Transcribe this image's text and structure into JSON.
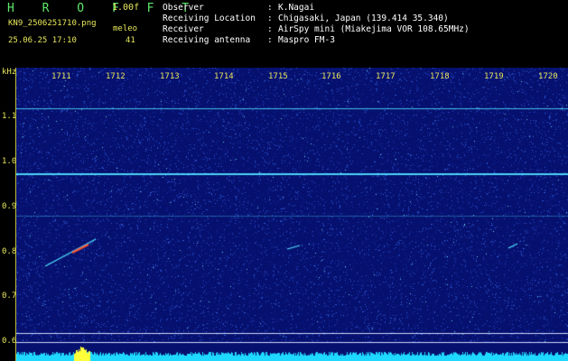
{
  "header": {
    "brand": "H R O F F T",
    "version": "1.00f",
    "filename": "KN9_2506251710.png",
    "meleo_label": "meleo",
    "meleo_value": "41",
    "datetime": "25.06.25 17:10"
  },
  "station": {
    "observer_label": "Observer",
    "observer_value": "K.Nagai",
    "location_label": "Receiving Location",
    "location_value": "Chigasaki, Japan (139.414 35.340)",
    "receiver_label": "Receiver",
    "receiver_value": "AirSpy mini (Miakejima VOR 108.65MHz)",
    "antenna_label": "Receiving antenna",
    "antenna_value": "Maspro FM-3",
    "separator": ":"
  },
  "spectrogram": {
    "y_unit": "kHz",
    "y_ticks": [
      "1.1",
      "1.0",
      "0.9",
      "0.8",
      "0.7",
      "0.6"
    ],
    "y_tick_values": [
      1.1,
      1.0,
      0.9,
      0.8,
      0.7,
      0.6
    ],
    "x_ticks": [
      "1711",
      "1712",
      "1713",
      "1714",
      "1715",
      "1716",
      "1717",
      "1718",
      "1719",
      "1720"
    ],
    "x_tick_minutes": [
      1711,
      1712,
      1713,
      1714,
      1715,
      1716,
      1717,
      1718,
      1719,
      1720
    ],
    "colors": {
      "background": "#06106e",
      "noise": "#2d5ad8",
      "noise_bright": "#6ad2ee",
      "carrier": "#4fe0ff",
      "meteor_core": "#ff5030",
      "axis_text": "#e8e85a",
      "bottom_bar": "#1fd8ff",
      "bottom_peak": "#ffff3a"
    }
  }
}
